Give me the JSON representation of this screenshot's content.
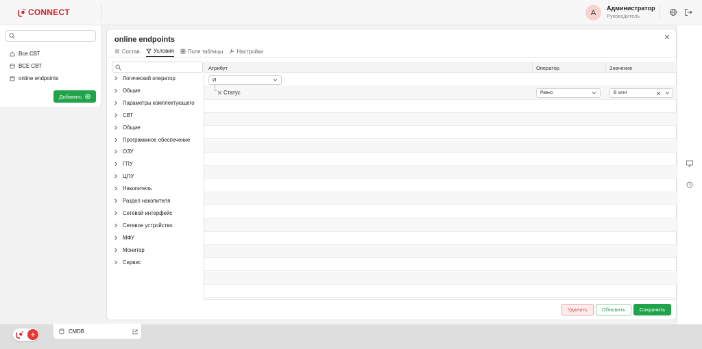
{
  "header": {
    "logo_text": "CONNECT",
    "user_initial": "A",
    "user_name": "Администратор",
    "user_role": "Руководитель",
    "icons": [
      "globe-icon",
      "logout-icon"
    ]
  },
  "sidebar": {
    "search_placeholder": "",
    "items": [
      {
        "label": "Все СВТ",
        "icon": "home-icon"
      },
      {
        "label": "ВСЕ СВТ",
        "icon": "database-icon"
      },
      {
        "label": "online endpoints",
        "icon": "database-icon"
      }
    ],
    "add_button": "Добавить"
  },
  "modal": {
    "title": "online endpoints",
    "tabs": [
      {
        "label": "Состав",
        "icon": "list-icon",
        "active": false
      },
      {
        "label": "Условия",
        "icon": "filter-icon",
        "active": true
      },
      {
        "label": "Поля таблицы",
        "icon": "grid-icon",
        "active": false
      },
      {
        "label": "Настройки",
        "icon": "wrench-icon",
        "active": false
      }
    ],
    "tree_items": [
      "Логический оператор",
      "Общие",
      "Параметры комплектующего",
      "СВТ",
      "Общие",
      "Программное обеспечение",
      "ОЗУ",
      "ГПУ",
      "ЦПУ",
      "Накопитель",
      "Раздел накопителя",
      "Сетевой интерфейс",
      "Сетевое устройство",
      "МФУ",
      "Монитор",
      "Сервис"
    ],
    "columns": [
      "Атрибут",
      "Оператор",
      "Значение"
    ],
    "logic_operator": "И",
    "condition": {
      "attribute": "Статус",
      "operator": "Равно",
      "value": "В сети"
    },
    "buttons": {
      "delete": "Удалить",
      "update": "Обновить",
      "save": "Сохранить"
    }
  },
  "taskbar": {
    "tab_label": "CMDB",
    "plus": "+"
  },
  "colors": {
    "brand": "#d32027",
    "primary_green": "#21a34a",
    "danger": "#d9534f"
  }
}
